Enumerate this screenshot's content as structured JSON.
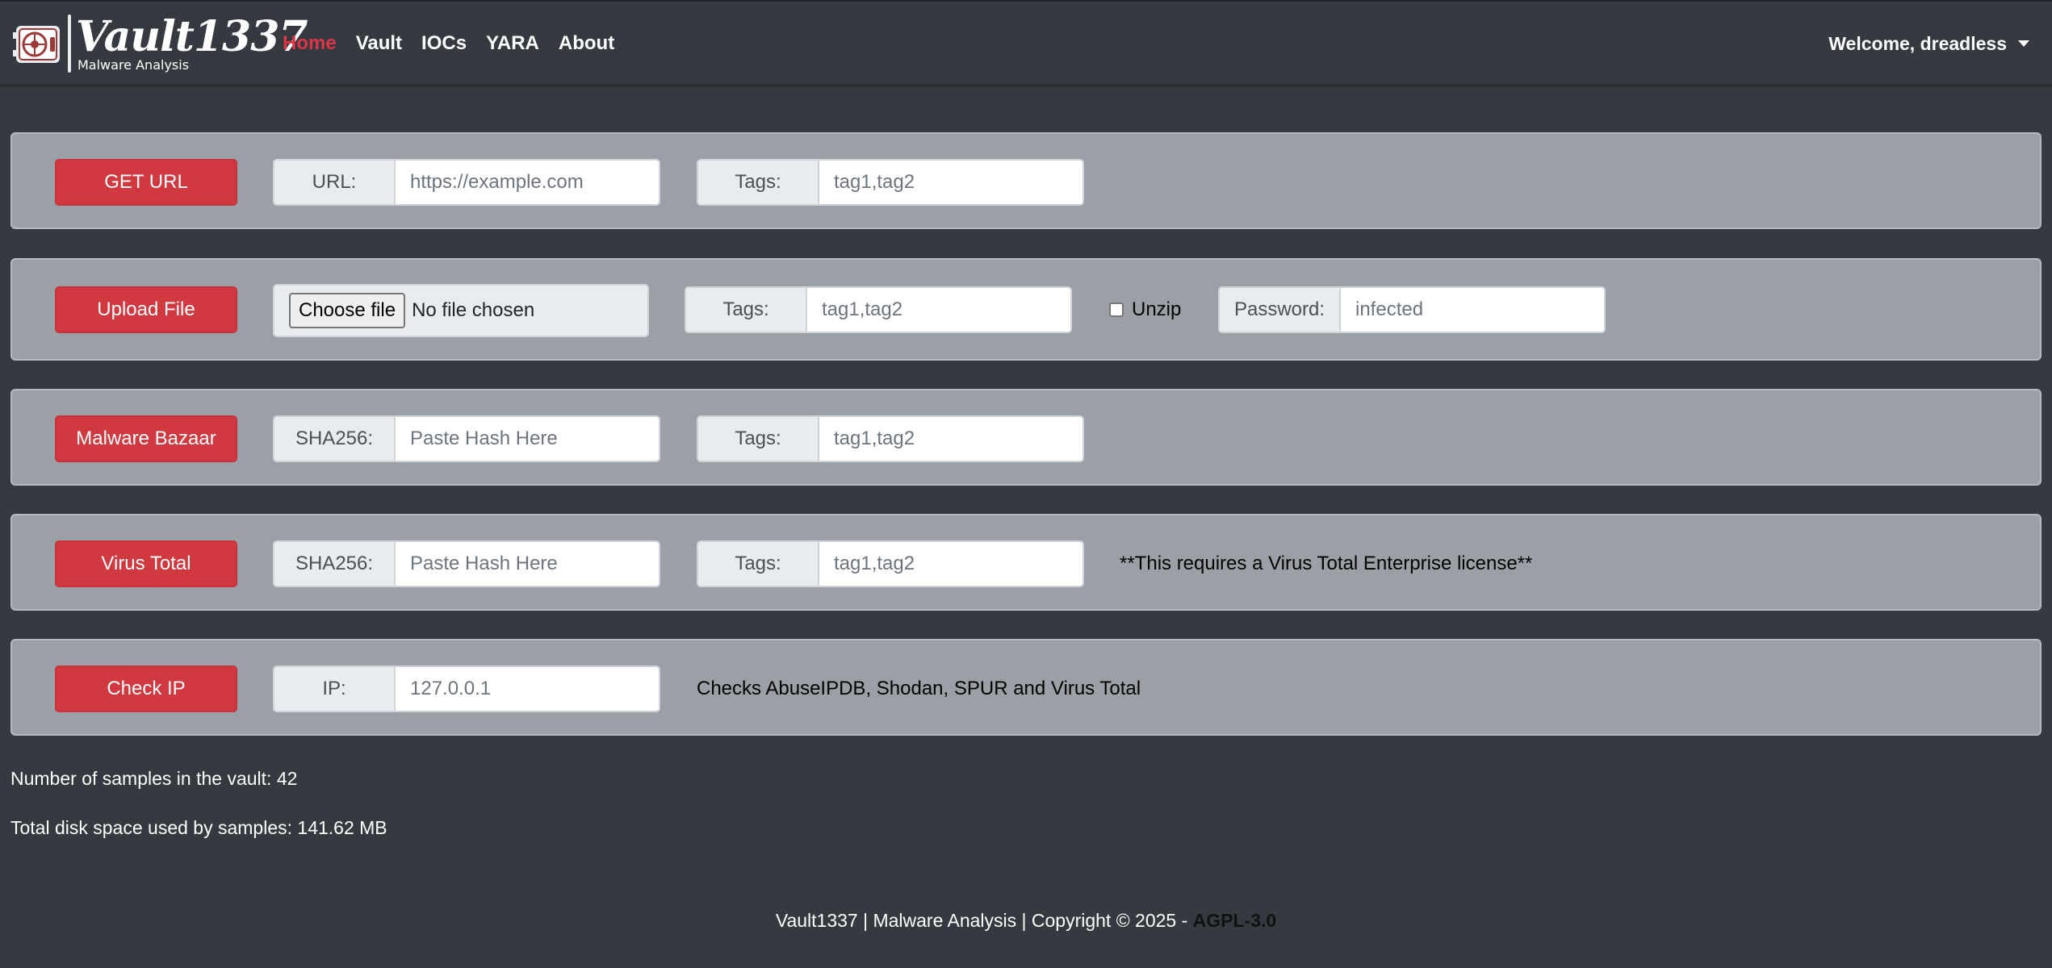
{
  "brand": {
    "name": "Vault1337",
    "subtitle": "Malware Analysis"
  },
  "nav": {
    "items": [
      {
        "label": "Home",
        "active": true
      },
      {
        "label": "Vault",
        "active": false
      },
      {
        "label": "IOCs",
        "active": false
      },
      {
        "label": "YARA",
        "active": false
      },
      {
        "label": "About",
        "active": false
      }
    ],
    "user": "Welcome, dreadless"
  },
  "get_url": {
    "button": "GET URL",
    "url_label": "URL:",
    "url_placeholder": "https://example.com",
    "tags_label": "Tags:",
    "tags_placeholder": "tag1,tag2"
  },
  "upload_file": {
    "button": "Upload File",
    "choose_label": "Choose file",
    "file_status": "No file chosen",
    "tags_label": "Tags:",
    "tags_placeholder": "tag1,tag2",
    "unzip_label": "Unzip",
    "unzip_checked": false,
    "password_label": "Password:",
    "password_placeholder": "infected"
  },
  "malware_bazaar": {
    "button": "Malware Bazaar",
    "hash_label": "SHA256:",
    "hash_placeholder": "Paste Hash Here",
    "tags_label": "Tags:",
    "tags_placeholder": "tag1,tag2"
  },
  "virus_total": {
    "button": "Virus Total",
    "hash_label": "SHA256:",
    "hash_placeholder": "Paste Hash Here",
    "tags_label": "Tags:",
    "tags_placeholder": "tag1,tag2",
    "note": "**This requires a Virus Total Enterprise license**"
  },
  "check_ip": {
    "button": "Check IP",
    "ip_label": "IP:",
    "ip_placeholder": "127.0.0.1",
    "note": "Checks AbuseIPDB, Shodan, SPUR and Virus Total"
  },
  "stats": {
    "samples": "Number of samples in the vault: 42",
    "disk": "Total disk space used by samples: 141.62 MB"
  },
  "footer": {
    "text": "Vault1337 | Malware Analysis | Copyright © 2025 - ",
    "license": "AGPL-3.0"
  },
  "colors": {
    "background": "#343a40",
    "card": "#9aa0a6",
    "accent_red": "#d0393f",
    "active_link": "#dc3545"
  },
  "icons": {
    "logo": "vault-logo-icon",
    "user_caret": "caret-down-icon"
  }
}
